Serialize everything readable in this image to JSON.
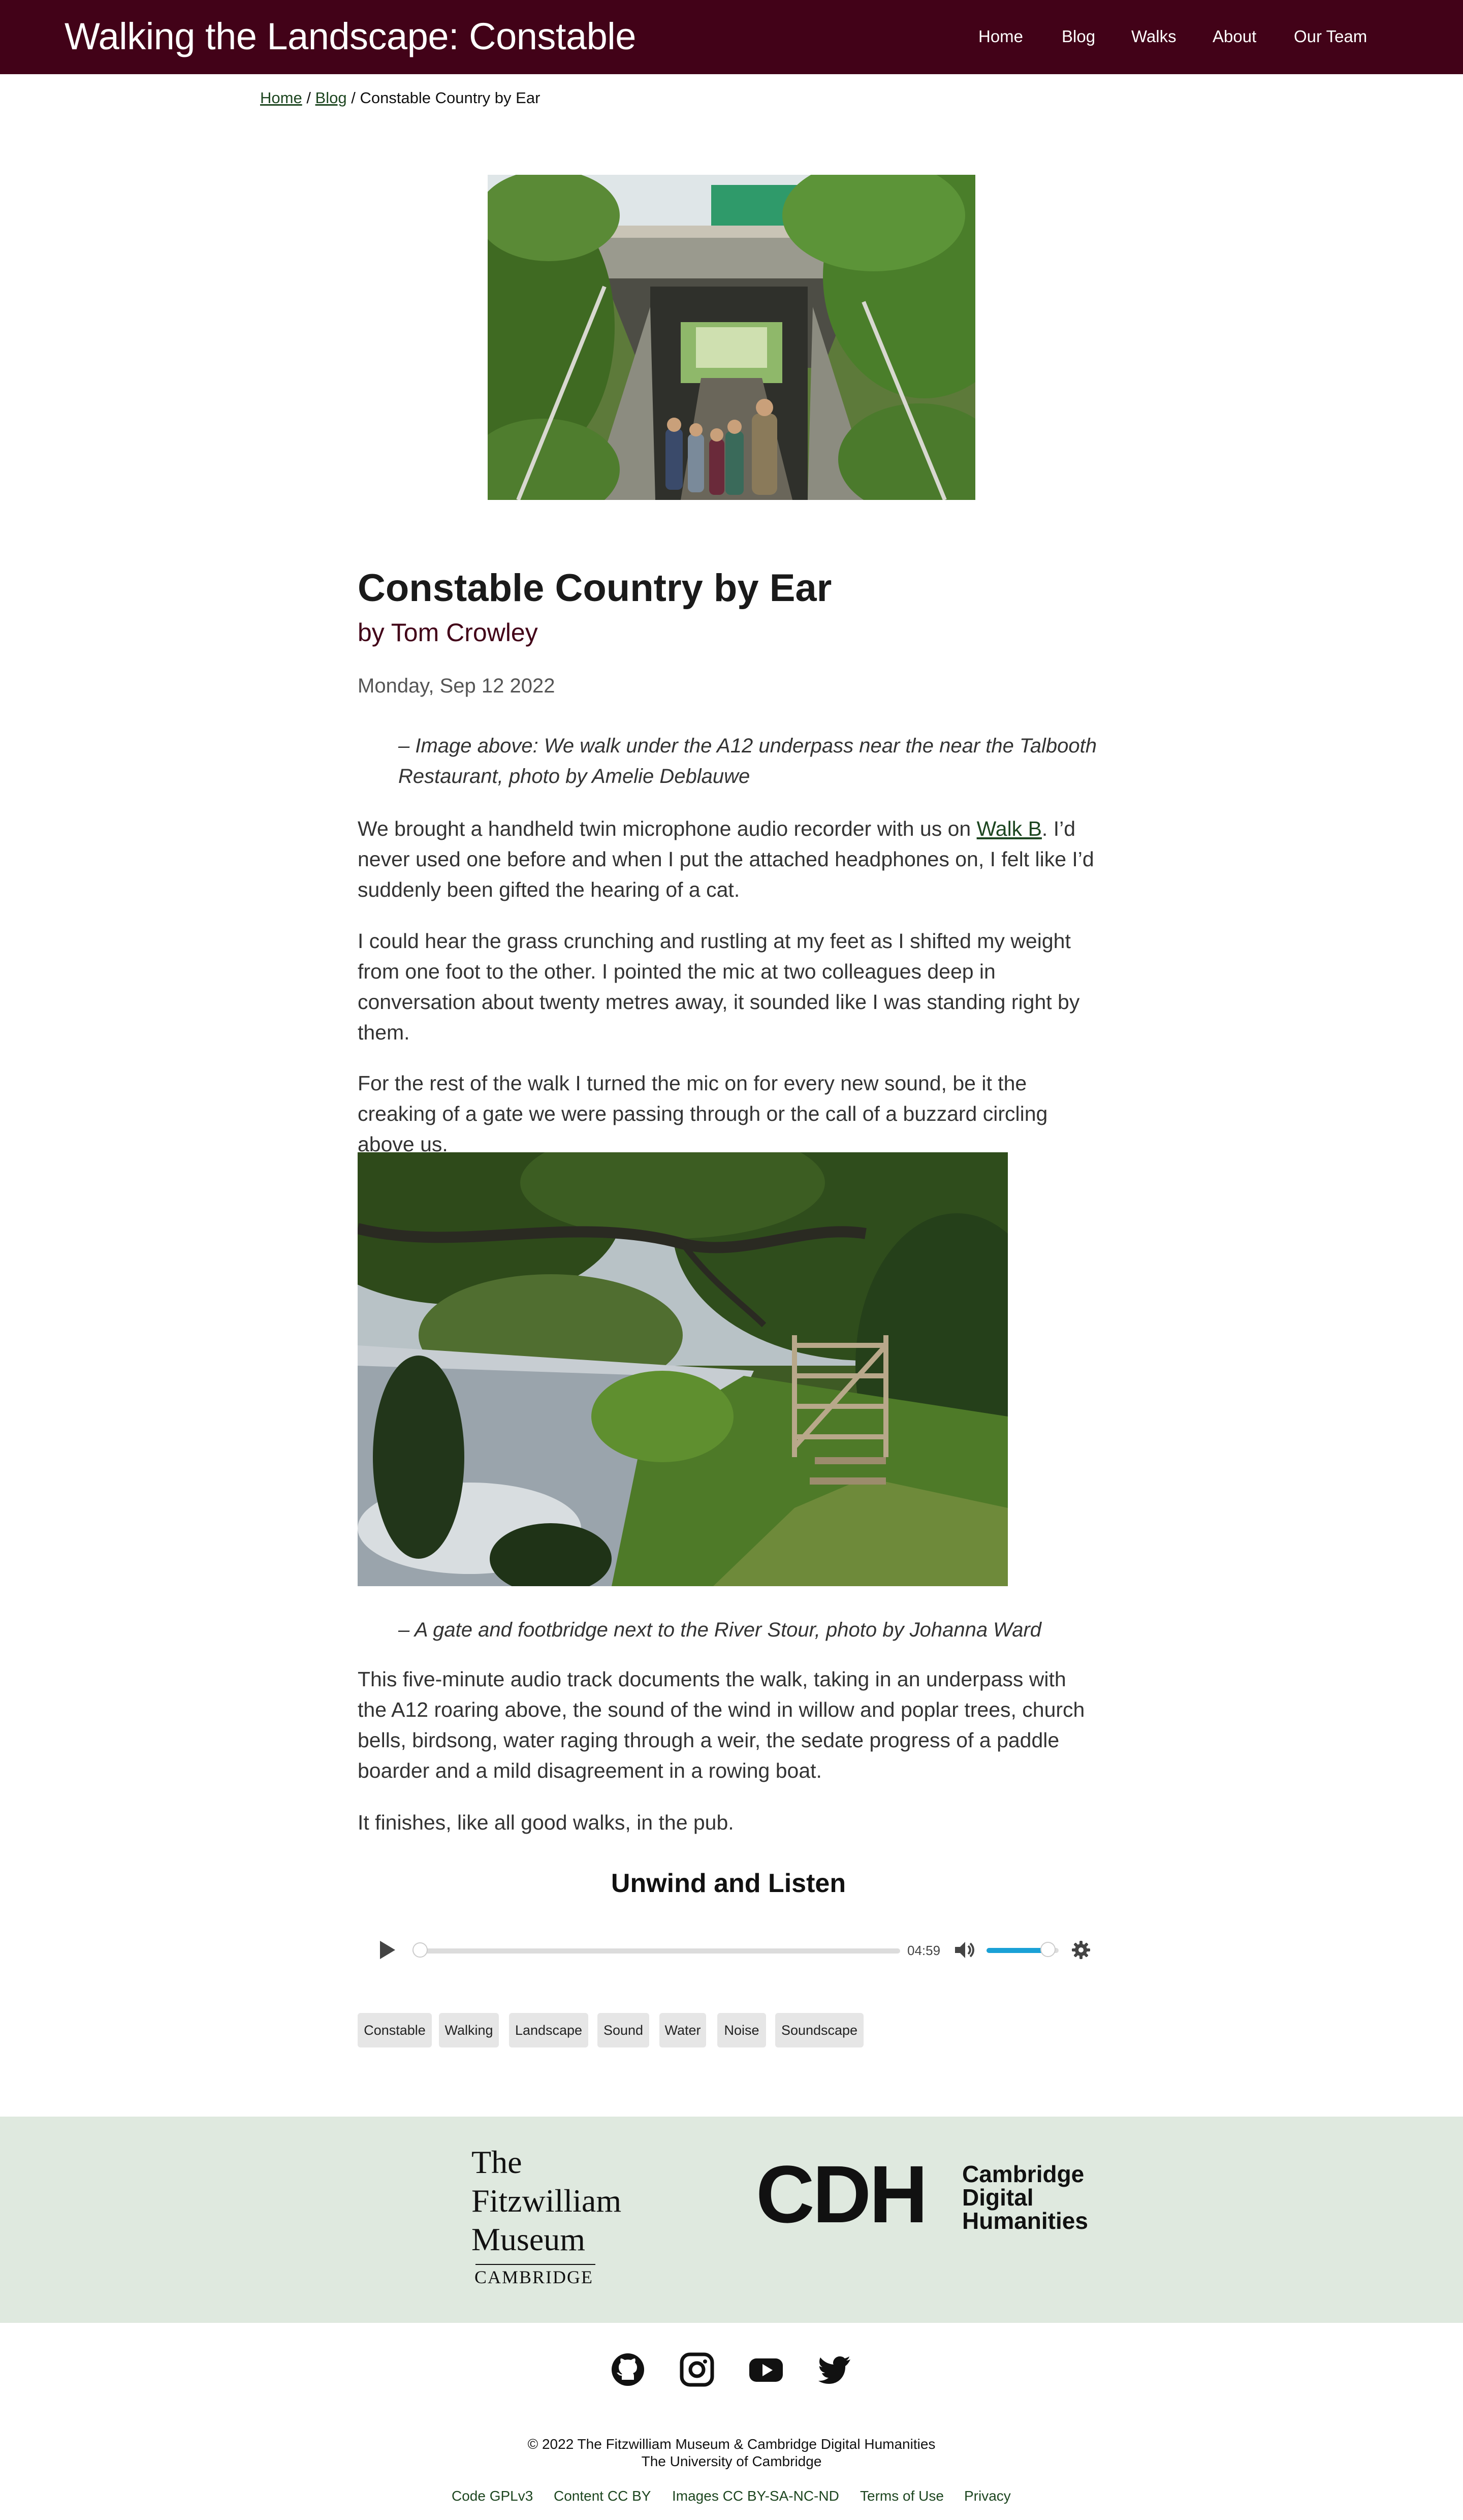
{
  "header": {
    "site_title": "Walking the Landscape: Constable",
    "nav": [
      "Home",
      "Blog",
      "Walks",
      "About",
      "Our Team"
    ]
  },
  "breadcrumb": {
    "home": "Home",
    "sep1": " / ",
    "blog": "Blog",
    "sep2": " / ",
    "current": "Constable Country by Ear"
  },
  "article": {
    "title": "Constable Country by Ear",
    "byline": "by Tom Crowley",
    "date": "Monday, Sep 12 2022",
    "caption1": "– Image above: We walk under the A12 underpass near the near the Talbooth Restaurant, photo by Amelie Deblauwe",
    "p1_before": "We brought a handheld twin microphone audio recorder with us on ",
    "p1_link": "Walk B",
    "p1_after": ". I’d never used one before and when I put the attached headphones on, I felt like I’d suddenly been gifted the hearing of a cat.",
    "p2": "I could hear the grass crunching and rustling at my feet as I shifted my weight from one foot to the other. I pointed the mic at two colleagues deep in conversation about twenty metres away, it sounded like I was standing right by them.",
    "p3": "For the rest of the walk I turned the mic on for every new sound, be it the creaking of a gate we were passing through or the call of a buzzard circling above us.",
    "caption2": "– A gate and footbridge next to the River Stour, photo by Johanna Ward",
    "p4": "This five-minute audio track documents the walk, taking in an underpass with the A12 roaring above, the sound of the wind in willow and poplar trees, church bells, birdsong, water raging through a weir, the sedate progress of a paddle boarder and a mild disagreement in a rowing boat.",
    "p5": "It finishes, like all good walks, in the pub."
  },
  "audio": {
    "heading": "Unwind and Listen",
    "duration": "04:59",
    "progress": 0,
    "volume": 0.85,
    "accent_color": "#1aa1d6",
    "icons": [
      "play-icon",
      "volume-icon",
      "gear-icon"
    ]
  },
  "tags": [
    "Constable",
    "Walking",
    "Landscape",
    "Sound",
    "Water",
    "Noise",
    "Soundscape"
  ],
  "sponsors": {
    "fitzwilliam_lines": [
      "The",
      "Fitzwilliam",
      "Museum"
    ],
    "fitzwilliam_sub": "CAMBRIDGE",
    "cdh_mark": "CDH",
    "cdh_lines": [
      "Cambridge",
      "Digital",
      "Humanities"
    ]
  },
  "social_icons": [
    "github-icon",
    "instagram-icon",
    "youtube-icon",
    "twitter-icon"
  ],
  "footer": {
    "copyright_line1": "© 2022 The Fitzwilliam Museum & Cambridge Digital Humanities",
    "copyright_line2": "The University of Cambridge",
    "links": [
      "Code GPLv3",
      "Content CC BY",
      "Images CC BY-SA-NC-ND",
      "Terms of Use",
      "Privacy"
    ]
  },
  "colors": {
    "header_bg": "#420218",
    "byline": "#420218",
    "link": "#1d4620",
    "sponsor_bg": "#dfe9df"
  }
}
